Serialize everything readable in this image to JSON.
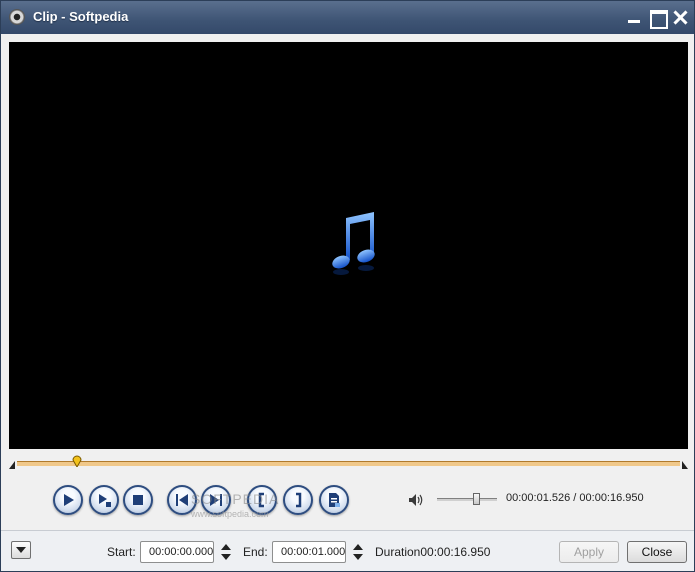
{
  "window": {
    "title": "Clip - Softpedia"
  },
  "player": {
    "time_current": "00:00:01.526",
    "time_separator": " / ",
    "time_total": "00:00:16.950",
    "timeline_position": 0.09,
    "volume_level": 0.65,
    "watermark": "SOFTPEDIA",
    "watermark_url": "www.softpedia.com"
  },
  "controls": {
    "icons": [
      "play-icon",
      "play-selection-icon",
      "stop-icon",
      "previous-frame-icon",
      "next-frame-icon",
      "set-start-icon",
      "set-end-icon",
      "export-clip-icon",
      "volume-icon"
    ]
  },
  "clip": {
    "start_label": "Start:",
    "start_value": "00:00:00.000",
    "end_label": "End:",
    "end_value": "00:00:01.000",
    "duration_label": "Duration",
    "duration_value": "00:00:16.950"
  },
  "buttons": {
    "apply": "Apply",
    "close": "Close"
  },
  "colors": {
    "accent": "#2e4d80",
    "timeline": "#f0c88a",
    "titlebar": "#3e5474"
  }
}
